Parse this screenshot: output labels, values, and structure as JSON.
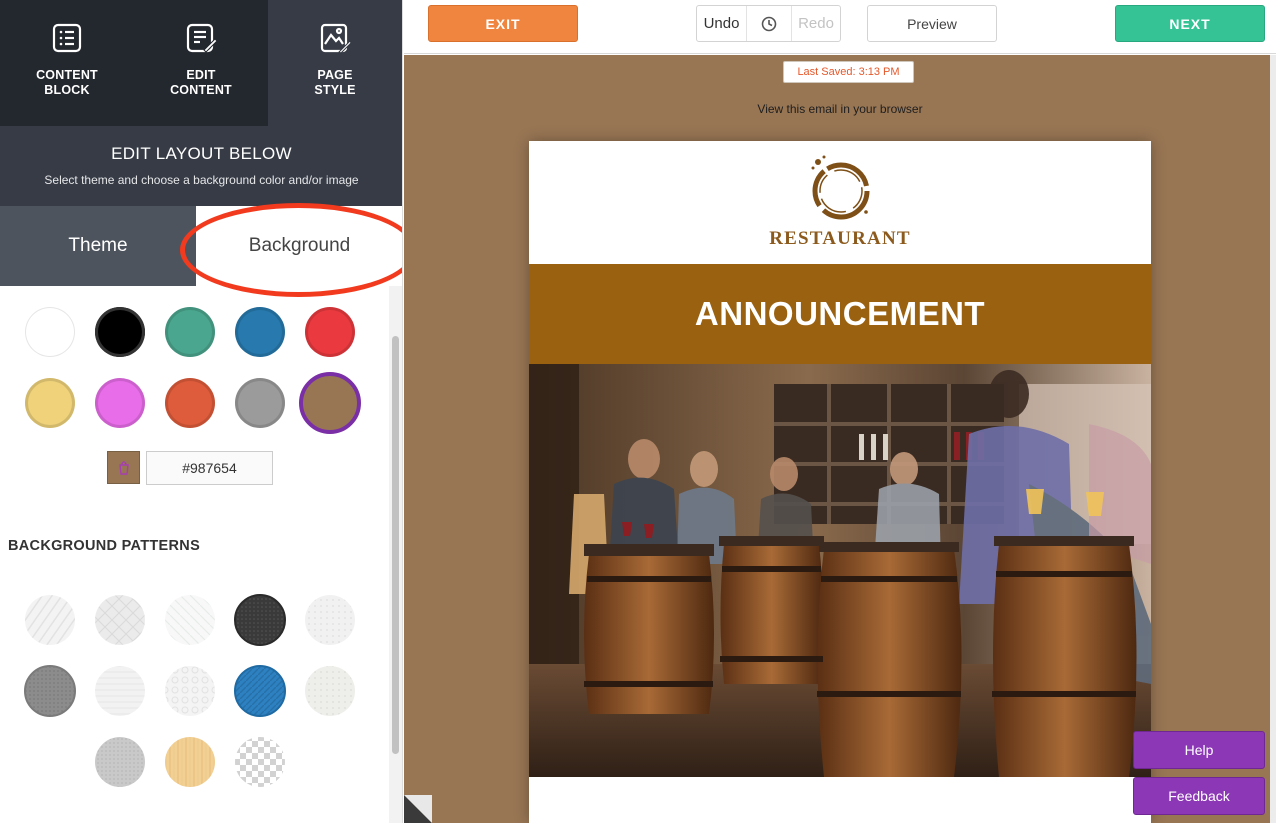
{
  "nav": {
    "items": [
      {
        "label": "CONTENT\nBLOCK",
        "icon": "content-block-icon"
      },
      {
        "label": "EDIT\nCONTENT",
        "icon": "edit-content-icon"
      },
      {
        "label": "PAGE\nSTYLE",
        "icon": "page-style-icon",
        "active": true
      }
    ]
  },
  "edit_layout": {
    "title": "EDIT LAYOUT BELOW",
    "subtitle": "Select theme and choose a background color and/or image"
  },
  "tabs": {
    "theme": "Theme",
    "background": "Background",
    "selected": "Background"
  },
  "swatches": [
    "#ffffff",
    "#000000",
    "#4aa68e",
    "#2779ae",
    "#ea3a3f",
    "#efd27a",
    "#e86de9",
    "#de5c3b",
    "#9b9b9b",
    "#987654"
  ],
  "selected_swatch": "#987654",
  "color_input": {
    "value": "#987654",
    "icon": "paint-bucket-icon"
  },
  "patterns": {
    "title": "BACKGROUND PATTERNS",
    "count": 13
  },
  "toolbar": {
    "exit": "EXIT",
    "undo": "Undo",
    "history_icon": "clock-icon",
    "redo": "Redo",
    "preview": "Preview",
    "next": "NEXT"
  },
  "canvas": {
    "background": "#987654",
    "last_saved": "Last Saved: 3:13 PM",
    "view_in_browser": "View this email in your browser"
  },
  "email": {
    "logo_text": "RESTAURANT",
    "banner": "ANNOUNCEMENT",
    "banner_color": "#9a6110",
    "hero_image": "restaurant-interior-photo"
  },
  "help": {
    "help": "Help",
    "feedback": "Feedback"
  }
}
